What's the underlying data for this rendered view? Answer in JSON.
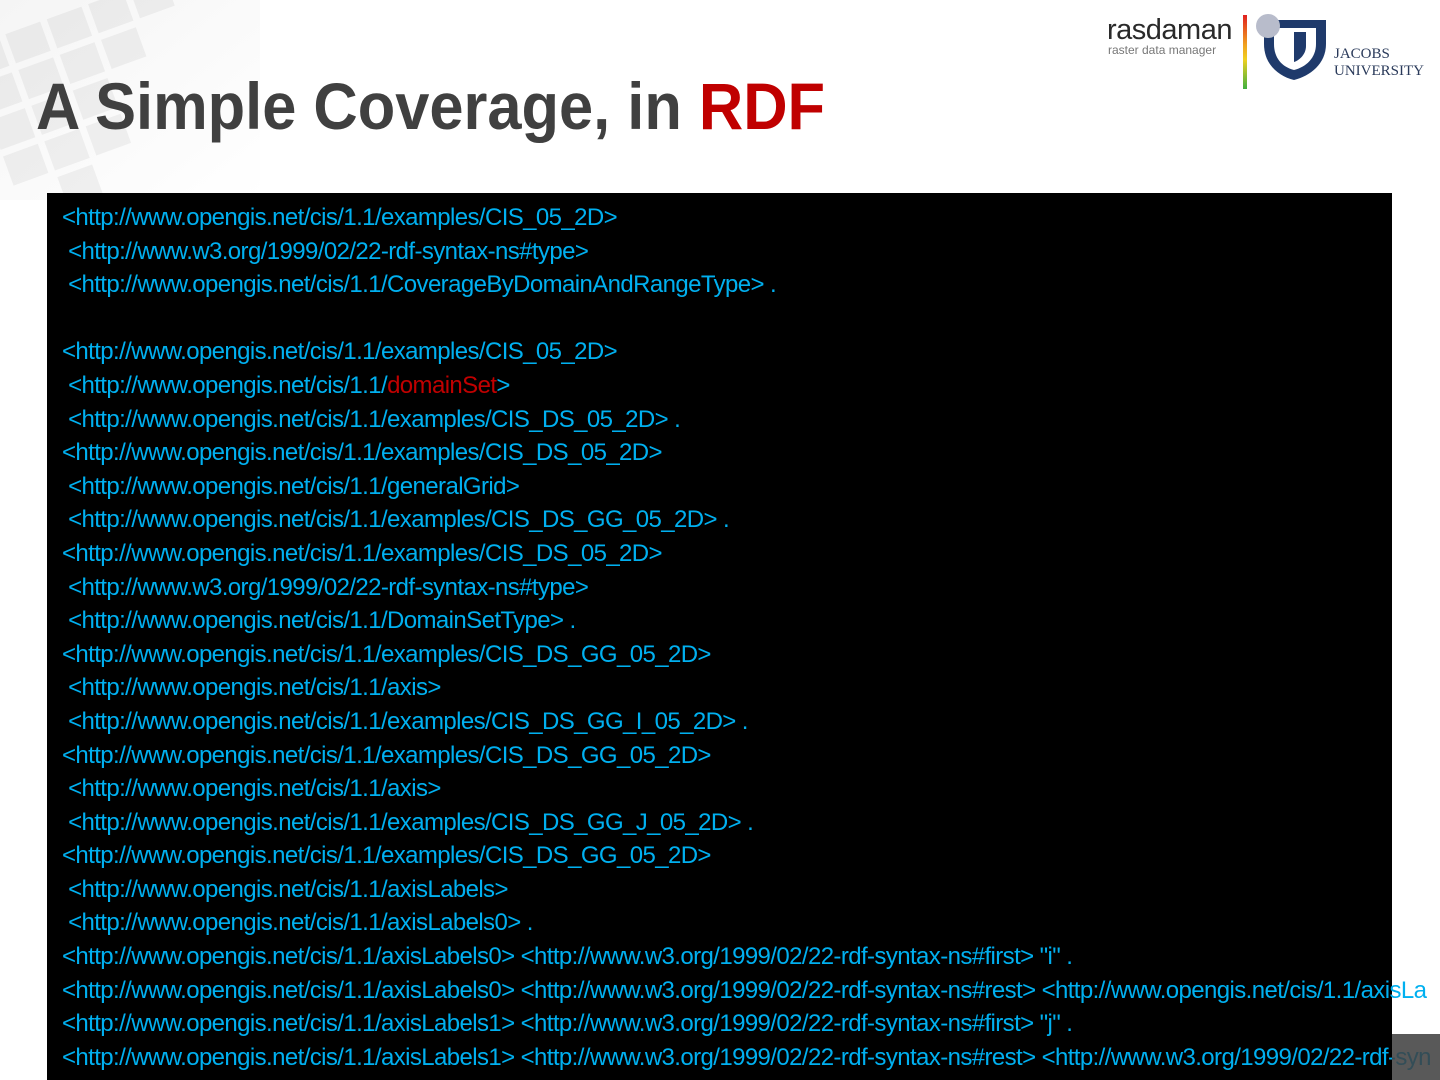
{
  "title": {
    "prefix": "A Simple Coverage, in ",
    "accent": "RDF"
  },
  "logo": {
    "rasdaman_name": "rasdaman",
    "rasdaman_tagline": "raster data manager",
    "jacobs_line1": "JACOBS",
    "jacobs_line2": "UNIVERSITY"
  },
  "colors": {
    "code_text": "#00b0f0",
    "highlight": "#c00000",
    "title_text": "#404040",
    "panel_bg": "#000000"
  },
  "code": {
    "lines": [
      {
        "pre": "<http://www.opengis.net/cis/1.1/examples/CIS_05_2D>",
        "hl": "",
        "post": ""
      },
      {
        "pre": " <http://www.w3.org/1999/02/22-rdf-syntax-ns#type>",
        "hl": "",
        "post": ""
      },
      {
        "pre": " <http://www.opengis.net/cis/1.1/CoverageByDomainAndRangeType> .",
        "hl": "",
        "post": ""
      },
      {
        "pre": "",
        "hl": "",
        "post": ""
      },
      {
        "pre": "<http://www.opengis.net/cis/1.1/examples/CIS_05_2D>",
        "hl": "",
        "post": ""
      },
      {
        "pre": " <http://www.opengis.net/cis/1.1/",
        "hl": "domainSet",
        "post": ">"
      },
      {
        "pre": " <http://www.opengis.net/cis/1.1/examples/CIS_DS_05_2D> .",
        "hl": "",
        "post": ""
      },
      {
        "pre": "<http://www.opengis.net/cis/1.1/examples/CIS_DS_05_2D>",
        "hl": "",
        "post": ""
      },
      {
        "pre": " <http://www.opengis.net/cis/1.1/generalGrid>",
        "hl": "",
        "post": ""
      },
      {
        "pre": " <http://www.opengis.net/cis/1.1/examples/CIS_DS_GG_05_2D> .",
        "hl": "",
        "post": ""
      },
      {
        "pre": "<http://www.opengis.net/cis/1.1/examples/CIS_DS_05_2D>",
        "hl": "",
        "post": ""
      },
      {
        "pre": " <http://www.w3.org/1999/02/22-rdf-syntax-ns#type>",
        "hl": "",
        "post": ""
      },
      {
        "pre": " <http://www.opengis.net/cis/1.1/DomainSetType> .",
        "hl": "",
        "post": ""
      },
      {
        "pre": "<http://www.opengis.net/cis/1.1/examples/CIS_DS_GG_05_2D>",
        "hl": "",
        "post": ""
      },
      {
        "pre": " <http://www.opengis.net/cis/1.1/axis>",
        "hl": "",
        "post": ""
      },
      {
        "pre": " <http://www.opengis.net/cis/1.1/examples/CIS_DS_GG_I_05_2D> .",
        "hl": "",
        "post": ""
      },
      {
        "pre": "<http://www.opengis.net/cis/1.1/examples/CIS_DS_GG_05_2D>",
        "hl": "",
        "post": ""
      },
      {
        "pre": " <http://www.opengis.net/cis/1.1/axis>",
        "hl": "",
        "post": ""
      },
      {
        "pre": " <http://www.opengis.net/cis/1.1/examples/CIS_DS_GG_J_05_2D> .",
        "hl": "",
        "post": ""
      },
      {
        "pre": "<http://www.opengis.net/cis/1.1/examples/CIS_DS_GG_05_2D>",
        "hl": "",
        "post": ""
      },
      {
        "pre": " <http://www.opengis.net/cis/1.1/axisLabels>",
        "hl": "",
        "post": ""
      },
      {
        "pre": " <http://www.opengis.net/cis/1.1/axisLabels0> .",
        "hl": "",
        "post": ""
      },
      {
        "pre": "<http://www.opengis.net/cis/1.1/axisLabels0> <http://www.w3.org/1999/02/22-rdf-syntax-ns#first> \"i\" .",
        "hl": "",
        "post": ""
      },
      {
        "pre": "<http://www.opengis.net/cis/1.1/axisLabels0> <http://www.w3.org/1999/02/22-rdf-syntax-ns#rest> <http://www.opengis.net/cis/1.1/axisLa",
        "hl": "",
        "post": ""
      },
      {
        "pre": "<http://www.opengis.net/cis/1.1/axisLabels1> <http://www.w3.org/1999/02/22-rdf-syntax-ns#first> \"j\" .",
        "hl": "",
        "post": ""
      },
      {
        "pre": "<http://www.opengis.net/cis/1.1/axisLabels1> <http://www.w3.org/1999/02/22-rdf-syntax-ns#rest> <http://www.w3.org/1999/02/22-rdf-syn",
        "hl": "",
        "post": ""
      }
    ]
  }
}
